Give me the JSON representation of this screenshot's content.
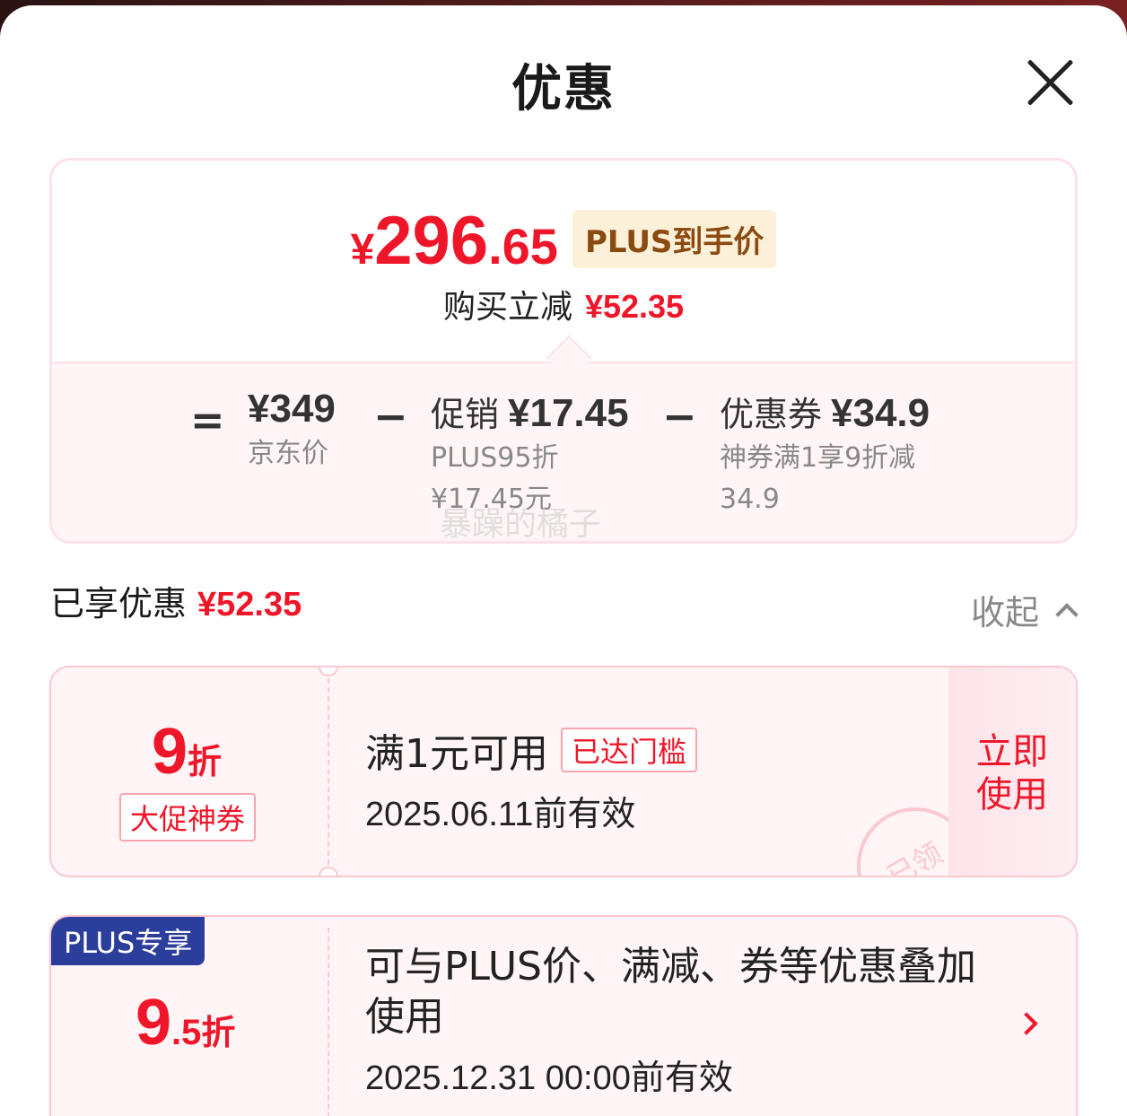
{
  "header": {
    "title": "优惠"
  },
  "summary": {
    "currency": "¥",
    "final_int": "296",
    "final_dec": ".65",
    "plus_tag": "PLUS到手价",
    "reduce_label": "购买立减",
    "reduce_amount": "¥52.35",
    "eq": "=",
    "jd_price": "¥349",
    "jd_label": "京东价",
    "minus": "−",
    "promo_label": "促销",
    "promo_amount": "¥17.45",
    "promo_sub1": "PLUS95折",
    "promo_sub2": "¥17.45元",
    "coupon_label": "优惠券",
    "coupon_amount": "¥34.9",
    "coupon_sub1": "神券满1享9折减",
    "coupon_sub2": "34.9",
    "watermark": "暴躁的橘子"
  },
  "enjoyed": {
    "label": "已享优惠",
    "amount": "¥52.35",
    "collapse": "收起"
  },
  "coupons": [
    {
      "disc_big": "9",
      "disc_unit": "折",
      "tag": "大促神券",
      "title": "满1元可用",
      "badge": "已达门槛",
      "date": "2025.06.11前有效",
      "action_line1": "立即",
      "action_line2": "使用",
      "stamp": "已领"
    },
    {
      "plus_badge": "PLUS专享",
      "disc_big": "9",
      "disc_small": ".5",
      "disc_unit": "折",
      "title": "可与PLUS价、满减、券等优惠叠加使用",
      "date": "2025.12.31 00:00前有效"
    }
  ],
  "colors": {
    "accent": "#f0162a",
    "plus_badge": "#2c3e9c",
    "plus_tag_bg": "#fdf0d8"
  }
}
